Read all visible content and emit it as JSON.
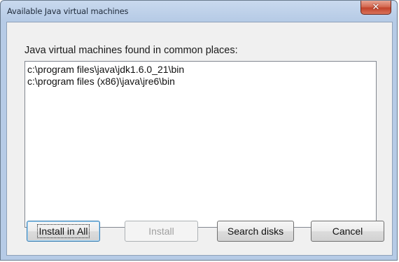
{
  "window": {
    "title": "Available Java virtual machines",
    "close_glyph": "✕"
  },
  "dialog": {
    "group_label": "Java virtual machines found in common places:",
    "jvm_list": [
      "c:\\program files\\java\\jdk1.6.0_21\\bin",
      "c:\\program files (x86)\\java\\jre6\\bin"
    ]
  },
  "buttons": {
    "install_all": "Install in All",
    "install": "Install",
    "search_disks": "Search disks",
    "cancel": "Cancel"
  },
  "colors": {
    "titlebar": "#c9d9ee",
    "close_button": "#c2432b",
    "dialog_face": "#f0f0f0",
    "disabled_text": "#a0a0a0"
  }
}
